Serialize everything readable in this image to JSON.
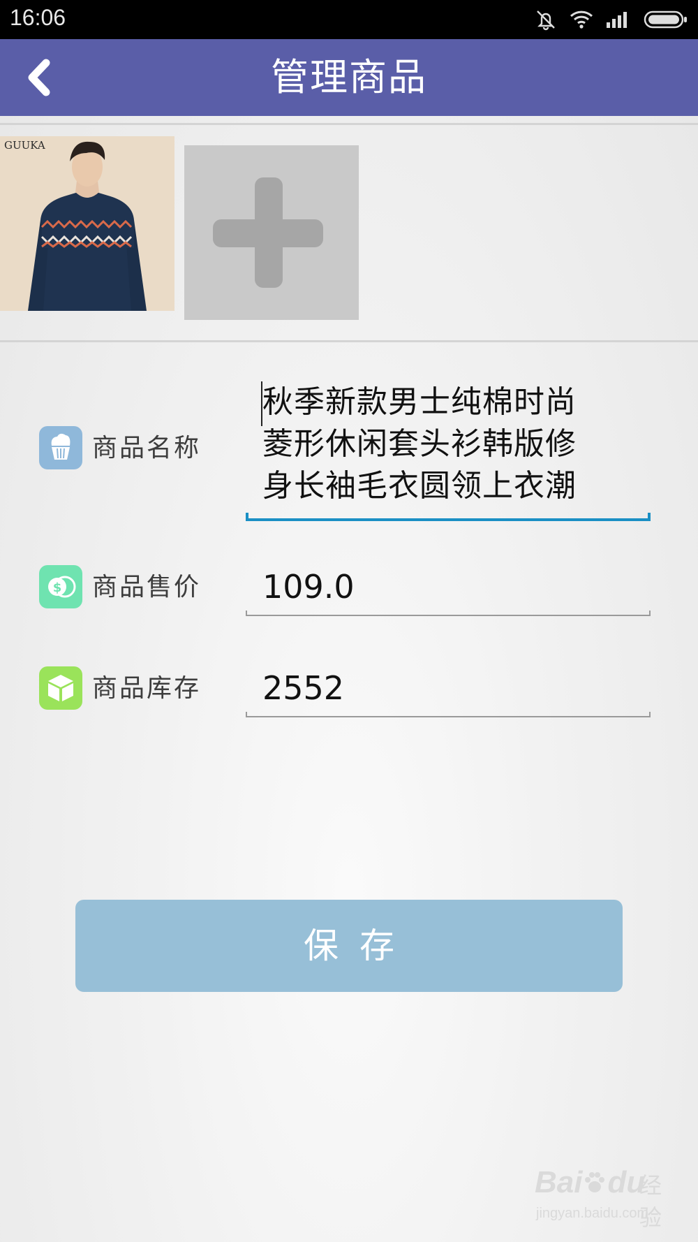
{
  "status_bar": {
    "time": "16:06",
    "icons": [
      "mute-icon",
      "wifi-icon",
      "signal-icon",
      "battery-icon"
    ]
  },
  "title_bar": {
    "title": "管理商品",
    "back_icon": "chevron-left-icon",
    "background": "#5a5ea8"
  },
  "photos": {
    "thumbnail_brand": "GUUKA",
    "add_icon": "plus-icon"
  },
  "form": {
    "name": {
      "label": "商品名称",
      "icon": "cupcake-icon",
      "icon_color": "#8fb8da",
      "value_lines": [
        "秋季新款男士纯棉时尚",
        "菱形休闲套头衫韩版修",
        "身长袖毛衣圆领上衣潮"
      ]
    },
    "price": {
      "label": "商品售价",
      "icon": "money-icon",
      "icon_color": "#6fe3b0",
      "value": "109.0"
    },
    "stock": {
      "label": "商品库存",
      "icon": "box-icon",
      "icon_color": "#9ae35a",
      "value": "2552"
    }
  },
  "save_button": {
    "label": "保存",
    "color": "#97bfd7"
  },
  "watermark": {
    "brand": "Bai",
    "brand_suffix": "du",
    "cn": "经验",
    "url": "jingyan.baidu.com"
  }
}
